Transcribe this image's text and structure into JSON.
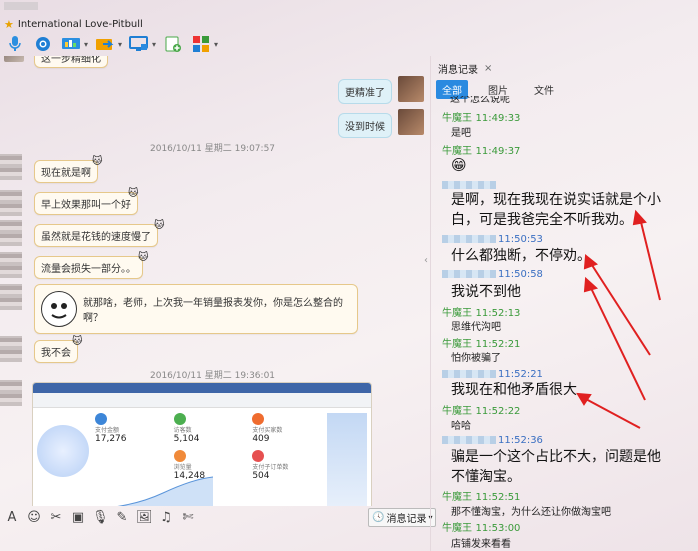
{
  "header": {
    "title": "International Love-Pitbull",
    "toolbar_icons": [
      "microphone-icon",
      "camera-icon",
      "screen-share-icon",
      "file-transfer-icon",
      "remote-desktop-icon",
      "add-app-icon",
      "apps-grid-icon"
    ]
  },
  "chat": {
    "messages_right": [
      {
        "text": "更精准了"
      },
      {
        "text": "没到时候"
      }
    ],
    "partial_top_text": "这一步精细化",
    "timestamp1": "2016/10/11 星期二 19:07:57",
    "messages_left": [
      {
        "text": "现在就是啊"
      },
      {
        "text": "早上效果那叫一个好"
      },
      {
        "text": "虽然就是花钱的速度慢了"
      },
      {
        "text": "流量会损失一部分。。"
      },
      {
        "text": "就那啥，老师，上次我一年销量报表发你，你是怎么整合的啊？"
      },
      {
        "text": "我不会"
      }
    ],
    "timestamp2": "2016/10/11 星期二 19:36:01",
    "screenshot": {
      "stats": [
        {
          "label": "支付金额",
          "value": "17,276"
        },
        {
          "label": "访客数",
          "value": "5,104"
        },
        {
          "label": "支付买家数",
          "value": "409"
        },
        {
          "label": "浏览量",
          "value": "14,248"
        },
        {
          "label": "支付子订单数",
          "value": "504"
        }
      ]
    }
  },
  "input_toolbar": {
    "history_label": "消息记录"
  },
  "panel": {
    "tab_label": "消息记录",
    "filters": [
      "全部",
      "图片",
      "文件"
    ],
    "records": [
      {
        "name": "",
        "time": "",
        "text": "这个怎么说呢",
        "size": "small",
        "partial": true
      },
      {
        "name": "牛魔王",
        "time": "11:49:33",
        "text": "是吧",
        "size": "small"
      },
      {
        "name": "牛魔王",
        "time": "11:49:37",
        "text": "😁",
        "size": "emoji"
      },
      {
        "name": "",
        "time": "",
        "text": "是啊，现在我现在说实话就是个小白，可是我爸完全不听我劝。",
        "size": "big"
      },
      {
        "name": "",
        "time": "11:50:53",
        "text": "什么都独断，不停劝。",
        "size": "big"
      },
      {
        "name": "",
        "time": "11:50:58",
        "text": "我说不到他",
        "size": "big"
      },
      {
        "name": "牛魔王",
        "time": "11:52:13",
        "text": "思维代沟吧",
        "size": "small"
      },
      {
        "name": "牛魔王",
        "time": "11:52:21",
        "text": "怕你被骗了",
        "size": "small"
      },
      {
        "name": "",
        "time": "11:52:21",
        "text": "我现在和他矛盾很大",
        "size": "big"
      },
      {
        "name": "牛魔王",
        "time": "11:52:22",
        "text": "哈哈",
        "size": "small"
      },
      {
        "name": "",
        "time": "11:52:36",
        "text": "骗是一个这个占比不大，问题是他不懂淘宝。",
        "size": "big"
      },
      {
        "name": "牛魔王",
        "time": "11:52:51",
        "text": "那不懂淘宝，为什么还让你做淘宝吧",
        "size": "small"
      },
      {
        "name": "牛魔王",
        "time": "11:53:00",
        "text": "店铺发来看看",
        "size": "small"
      }
    ]
  },
  "colors": {
    "accent": "#2a8ae0",
    "sender_green": "#3a9a3a",
    "time_blue": "#3a6fc2",
    "annotation_red": "#e02020"
  }
}
